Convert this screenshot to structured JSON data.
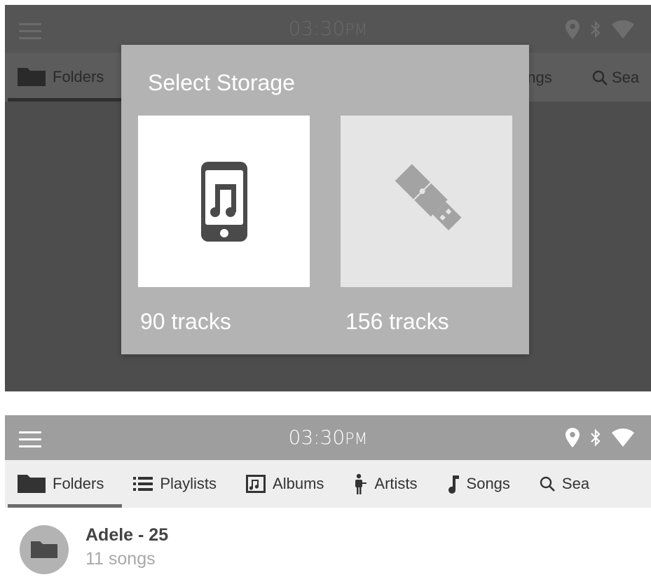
{
  "status_bar": {
    "time": "03:30",
    "ampm": "PM",
    "icons": [
      "location-icon",
      "bluetooth-icon",
      "wifi-icon"
    ]
  },
  "tabs": [
    {
      "label": "Folders",
      "icon": "folder-icon",
      "active": true
    },
    {
      "label": "Playlists",
      "icon": "list-icon"
    },
    {
      "label": "Albums",
      "icon": "album-icon"
    },
    {
      "label": "Artists",
      "icon": "artist-icon"
    },
    {
      "label": "Songs",
      "icon": "note-icon"
    },
    {
      "label": "Sea",
      "icon": "search-icon"
    }
  ],
  "dimmed_tabs": {
    "folders": "Folders",
    "songs_partial": "ongs",
    "search_partial": "Sea"
  },
  "dialog": {
    "title": "Select Storage",
    "options": [
      {
        "icon": "phone-music-icon",
        "count": "90 tracks"
      },
      {
        "icon": "usb-drive-icon",
        "count": "156 tracks"
      }
    ]
  },
  "folders": [
    {
      "title": "Adele - 25",
      "subtitle": "11 songs",
      "icon": "folder-icon"
    }
  ],
  "colors": {
    "header_bg": "#9e9e9e",
    "tabbar_bg": "#eeeeee",
    "dialog_bg": "#b3b3b3",
    "overlay_bg": "#4d4d4d"
  }
}
